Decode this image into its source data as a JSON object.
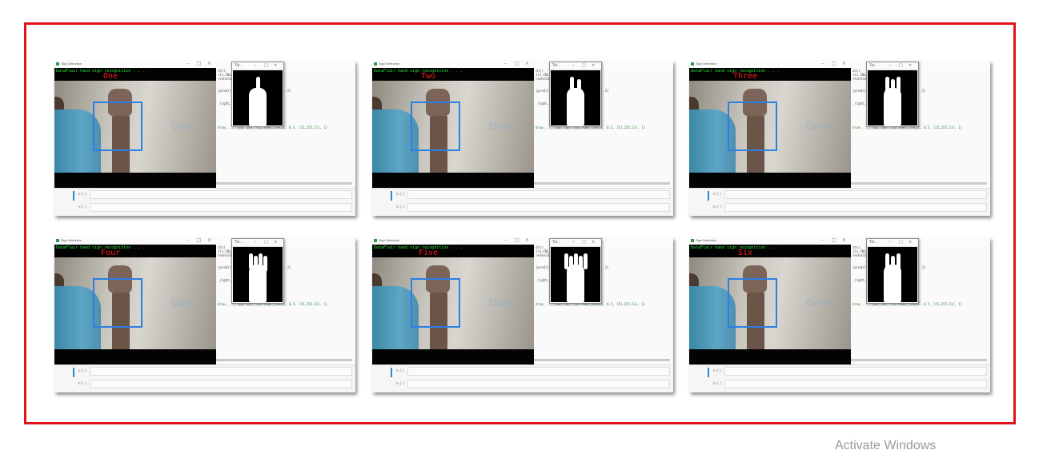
{
  "panels": [
    {
      "label": "One",
      "fingers": 1
    },
    {
      "label": "Two",
      "fingers": 2
    },
    {
      "label": "Three",
      "fingers": 3
    },
    {
      "label": "Four",
      "fingers": 4
    },
    {
      "label": "Five",
      "fingers": 5
    },
    {
      "label": "Six",
      "fingers": 3
    }
  ],
  "window_title": "Sign Detection",
  "mini_window_title": "Thr...",
  "status_text": "DataFlair hand sign recognition . . .",
  "code_lines": [
    "ch()",
    "ils.CNL.HW_...",
    "resholds..,  (0,0)",
    "(pred)],  ..t_SIMPLEX, 1, (0,0,255), 2)",
    "_right, ..., 255,0), 3)",
    "draw_..., (10, 20), cv2.FONT_ITALIC, 0.5, (51,255,51), 1)"
  ],
  "cell_prompt": "In [ ]:",
  "watermark_text": "Data",
  "watermark_sub": "Flair",
  "activate_text": "Activate Windows",
  "colors": {
    "frame_border": "#e2111b",
    "label": "#ff1c1c",
    "status": "#27e33b",
    "roi": "#2d7fe3"
  }
}
